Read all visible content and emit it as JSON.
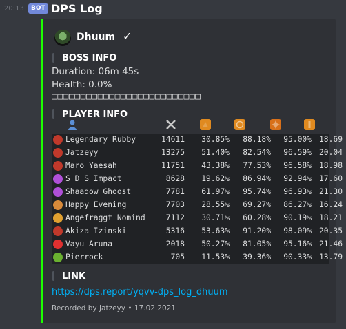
{
  "message": {
    "timestamp": "20:13",
    "bot_tag": "BOT",
    "author": "DPS Log"
  },
  "embed": {
    "author_name": "Dhuum",
    "check": "✓",
    "accent_color": "#1dff00",
    "boss_title": "BOSS INFO",
    "duration": "Duration: 06m 45s",
    "health": "Health: 0.0%",
    "health_boxes": "□□□□□□□□□□□□□□□□□□□□□□□□□□",
    "player_title": "PLAYER INFO",
    "table_headers": {
      "name_icon": "user-icon",
      "dps_icon": "swords-icon",
      "p1_icon": "speed-icon",
      "p2_icon": "shield-icon",
      "p3_icon": "burst-icon",
      "p4_icon": "might-icon"
    },
    "players": [
      {
        "name": "Legendary Rubby",
        "dps": "14611",
        "p1": "30.85%",
        "p2": "88.18%",
        "p3": "95.00%",
        "p4": "18.69",
        "prof_color": "#c0392b"
      },
      {
        "name": "Jatzeyy",
        "dps": "13275",
        "p1": "51.40%",
        "p2": "82.54%",
        "p3": "96.59%",
        "p4": "20.04",
        "prof_color": "#c0392b"
      },
      {
        "name": "Maro Yaesah",
        "dps": "11751",
        "p1": "43.38%",
        "p2": "77.53%",
        "p3": "96.58%",
        "p4": "18.98",
        "prof_color": "#c0392b"
      },
      {
        "name": "S D S Impact",
        "dps": "8628",
        "p1": "19.62%",
        "p2": "86.94%",
        "p3": "92.94%",
        "p4": "17.60",
        "prof_color": "#b050d8"
      },
      {
        "name": "Shaadow Ghoost",
        "dps": "7781",
        "p1": "61.97%",
        "p2": "95.74%",
        "p3": "96.93%",
        "p4": "21.30",
        "prof_color": "#b050d8"
      },
      {
        "name": "Happy Evening",
        "dps": "7703",
        "p1": "28.55%",
        "p2": "69.27%",
        "p3": "86.27%",
        "p4": "16.24",
        "prof_color": "#d88a3a"
      },
      {
        "name": "Angefraggt Nomind",
        "dps": "7112",
        "p1": "30.71%",
        "p2": "60.28%",
        "p3": "90.19%",
        "p4": "18.21",
        "prof_color": "#e0a030"
      },
      {
        "name": "Akiza Izinski",
        "dps": "5316",
        "p1": "53.63%",
        "p2": "91.20%",
        "p3": "98.09%",
        "p4": "20.35",
        "prof_color": "#c0392b"
      },
      {
        "name": "Vayu Aruna",
        "dps": "2018",
        "p1": "50.27%",
        "p2": "81.05%",
        "p3": "95.16%",
        "p4": "21.46",
        "prof_color": "#e03030"
      },
      {
        "name": "Pierrock",
        "dps": "705",
        "p1": "11.53%",
        "p2": "39.36%",
        "p3": "90.33%",
        "p4": "13.79",
        "prof_color": "#6ab030"
      }
    ],
    "link_title": "LINK",
    "link_url": "https://dps.report/yqvv-dps_log_dhuum",
    "footer": "Recorded by Jatzeyy • 17.02.2021"
  }
}
